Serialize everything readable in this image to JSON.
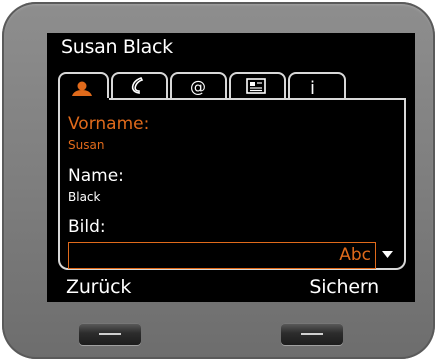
{
  "screen": {
    "title": "Susan Black"
  },
  "tabs": [
    {
      "name": "person-icon",
      "active": true
    },
    {
      "name": "phone-icon",
      "active": false
    },
    {
      "name": "at-icon",
      "active": false
    },
    {
      "name": "address-card-icon",
      "active": false
    },
    {
      "name": "info-icon",
      "active": false
    }
  ],
  "fields": {
    "first_name_label": "Vorname:",
    "first_name_value": "Susan",
    "last_name_label": "Name:",
    "last_name_value": "Black",
    "picture_label": "Bild:",
    "picture_input_mode": "Abc"
  },
  "softkeys": {
    "left": "Zurück",
    "right": "Sichern"
  },
  "colors": {
    "focus": "#e06a1b",
    "screen_bg": "#000000",
    "device_body": "#7b7b7b"
  }
}
